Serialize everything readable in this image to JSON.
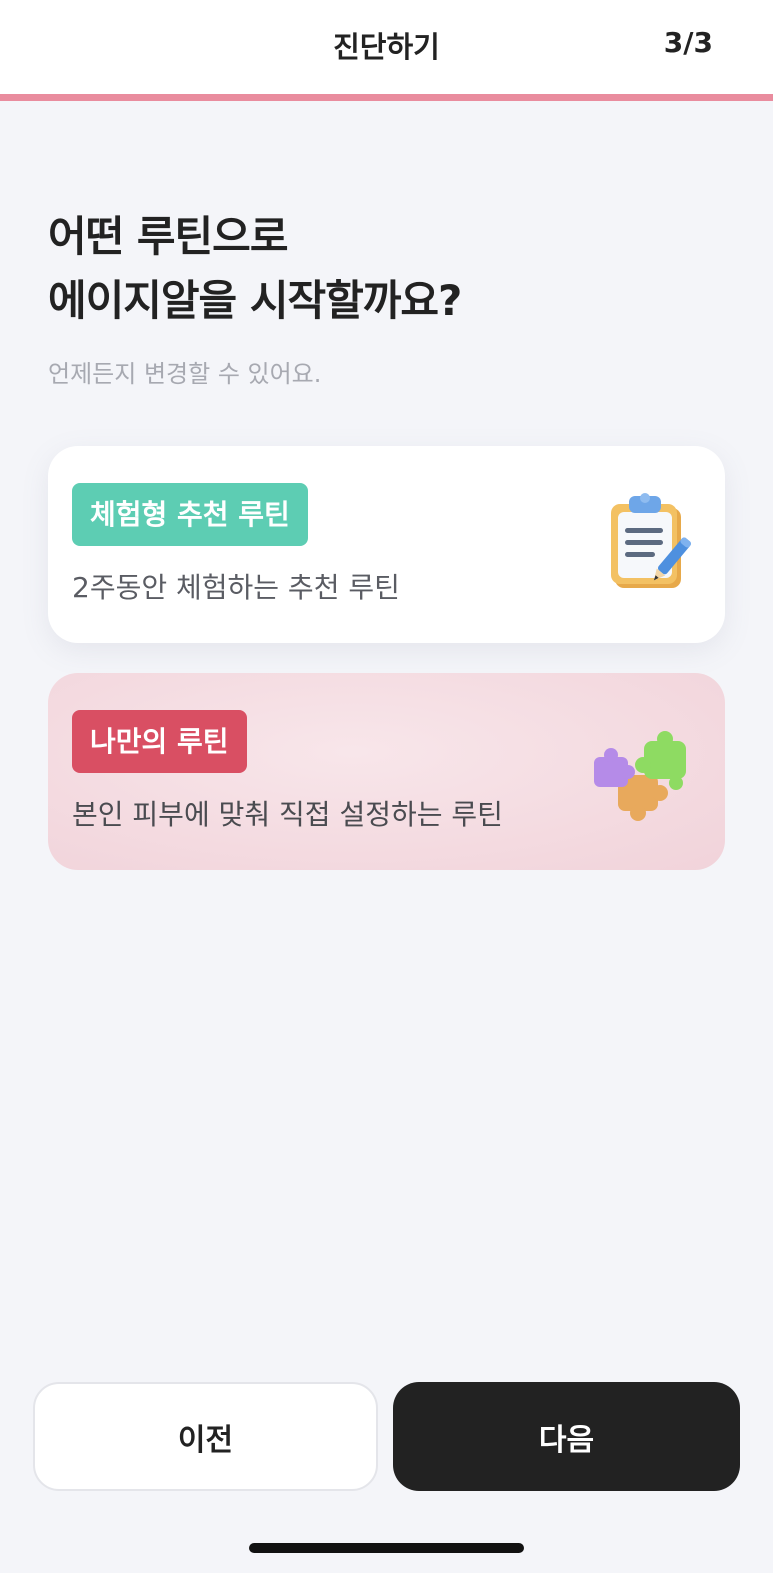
{
  "header": {
    "title": "진단하기",
    "step": "3/3",
    "progress": 1.0
  },
  "main": {
    "question_line1": "어떤 루틴으로",
    "question_line2": "에이지알을 시작할까요?",
    "subtitle": "언제든지 변경할 수 있어요."
  },
  "options": [
    {
      "badge": "체험형 추천 루틴",
      "description": "2주동안 체험하는 추천 루틴",
      "badge_color": "#5dcdb3",
      "icon": "clipboard-icon",
      "selected": false
    },
    {
      "badge": "나만의 루틴",
      "description": "본인 피부에 맞춰 직접 설정하는 루틴",
      "badge_color": "#d94f63",
      "icon": "puzzle-icon",
      "selected": true
    }
  ],
  "footer": {
    "prev_label": "이전",
    "next_label": "다음"
  },
  "colors": {
    "accent": "#e98c9e",
    "selected_bg": "#f1d3da",
    "primary_button": "#222222"
  }
}
